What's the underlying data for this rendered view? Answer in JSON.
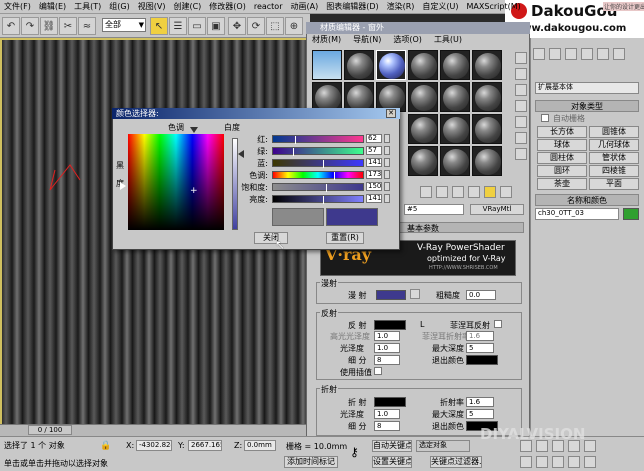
{
  "menubar": {
    "items": [
      "文件(F)",
      "编辑(E)",
      "工具(T)",
      "组(G)",
      "视图(V)",
      "创建(C)",
      "修改器(O)",
      "reactor",
      "动画(A)",
      "图表编辑器(D)",
      "渲染(R)",
      "自定义(U)",
      "MAXScript(M)"
    ]
  },
  "toolbar": {
    "selection_filter": "全部"
  },
  "logo": {
    "text": "DakouGou",
    "url": "www.dakougou.com",
    "tagline": "让你的设计更出色"
  },
  "viewport": {
    "label": ""
  },
  "timeline": {
    "frame": "0 / 100"
  },
  "status": {
    "selected": "选择了 1 个 对象",
    "hint": "单击或单击并拖动以选择对象",
    "x_label": "X:",
    "x_value": "-4302.824",
    "y_label": "Y:",
    "y_value": "2667.165",
    "z_label": "Z:",
    "z_value": "0.0mm",
    "grid": "栅格 = 10.0mm",
    "add_time_tag": "添加时间标记",
    "auto_key": "自动关键点",
    "set_key": "设置关键点",
    "selected_obj": "选定对象",
    "key_filters": "关键点过滤器...",
    "watermark": "DIYALVISION"
  },
  "cmdpanel": {
    "dropdown": "扩展基本体",
    "object_type_title": "对象类型",
    "autogrid": "自动栅格",
    "buttons": [
      "长方体",
      "圆锥体",
      "球体",
      "几何球体",
      "圆柱体",
      "管状体",
      "圆环",
      "四棱锥",
      "茶壶",
      "平面"
    ],
    "name_color_title": "名称和颜色",
    "name_value": "ch30_0TT_03"
  },
  "mated": {
    "title": "材质编辑器 - 窗外",
    "menu": [
      "材质(M)",
      "导航(N)",
      "选项(O)",
      "工具(U)"
    ],
    "material_name": "#5",
    "material_type": "VRayMtl",
    "basic_params_title": "基本参数",
    "vray_title": "V-Ray PowerShader",
    "vray_sub": "optimized for V-Ray",
    "vray_url": "HTTP://WWW.SHRISEB.COM",
    "vray_logo": "V·ray",
    "diffuse_group": "漫射",
    "diffuse_label": "漫 射",
    "roughness_label": "粗糙度",
    "roughness_value": "0.0",
    "reflect_group": "反射",
    "reflect_label": "反 射",
    "hilight_label": "高光光泽度",
    "hilight_value": "1.0",
    "gloss_label": "光泽度",
    "gloss_value": "1.0",
    "subdiv_label": "细 分",
    "subdiv_value": "8",
    "interp_label": "使用插值",
    "fresnel_label": "菲涅耳反射",
    "fresnel_ior_label": "菲涅耳折射率",
    "fresnel_ior_value": "1.6",
    "max_depth_label": "最大深度",
    "max_depth_value": "5",
    "exit_color_label": "退出颜色",
    "refract_group": "折射",
    "refract_label": "折 射",
    "ior_label": "折射率",
    "ior_value": "1.6",
    "r_gloss_label": "光泽度",
    "r_gloss_value": "1.0",
    "r_max_depth_label": "最大深度",
    "r_max_depth_value": "5",
    "r_subdiv_label": "细 分",
    "r_subdiv_value": "8",
    "r_exit_color_label": "退出颜色",
    "l_label": "L"
  },
  "colordlg": {
    "title": "颜色选择器:",
    "hue_label": "色调",
    "whiteness_label": "白度",
    "blackness_label": "黑",
    "blackness_label2": "度",
    "rows": [
      {
        "label": "红:",
        "value": "62",
        "pos": 0.24
      },
      {
        "label": "绿:",
        "value": "57",
        "pos": 0.22
      },
      {
        "label": "蓝:",
        "value": "141",
        "pos": 0.55
      },
      {
        "label": "色调:",
        "value": "173",
        "pos": 0.68
      },
      {
        "label": "饱和度:",
        "value": "150",
        "pos": 0.59
      },
      {
        "label": "亮度:",
        "value": "141",
        "pos": 0.55
      }
    ],
    "close_btn": "关闭",
    "reset_btn": "重置(R)",
    "colors": {
      "old": "#8a8a8a",
      "new": "#3e398d"
    }
  }
}
